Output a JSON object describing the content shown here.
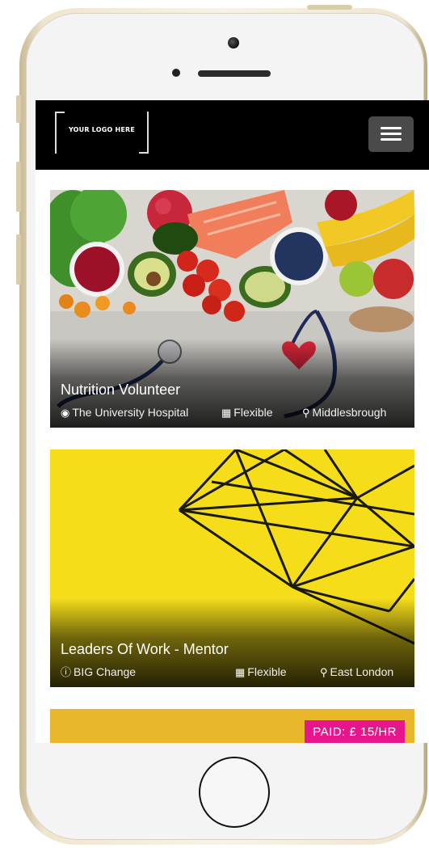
{
  "navbar": {
    "logo_text": "YOUR LOGO HERE",
    "menu_icon": "hamburger-menu-icon"
  },
  "cards": [
    {
      "title": "Nutrition Volunteer",
      "organisation": "The University Hospital",
      "organisation_icon": "user-circle-icon",
      "schedule": "Flexible",
      "schedule_icon": "calendar-icon",
      "location": "Middlesbrough",
      "location_icon": "map-pin-icon",
      "image": "healthy-food-and-stethoscope"
    },
    {
      "title": "Leaders Of Work - Mentor",
      "organisation": "BIG Change",
      "organisation_icon": "info-circle-icon",
      "schedule": "Flexible",
      "schedule_icon": "calendar-icon",
      "location": "East London",
      "location_icon": "map-pin-icon",
      "image": "geometric-wire-sculpture-on-yellow"
    },
    {
      "badge": "PAID: £ 15/HR"
    }
  ],
  "colors": {
    "navbar_bg": "#000000",
    "badge_bg": "#e8168c",
    "card2_bg": "#f4db18"
  }
}
